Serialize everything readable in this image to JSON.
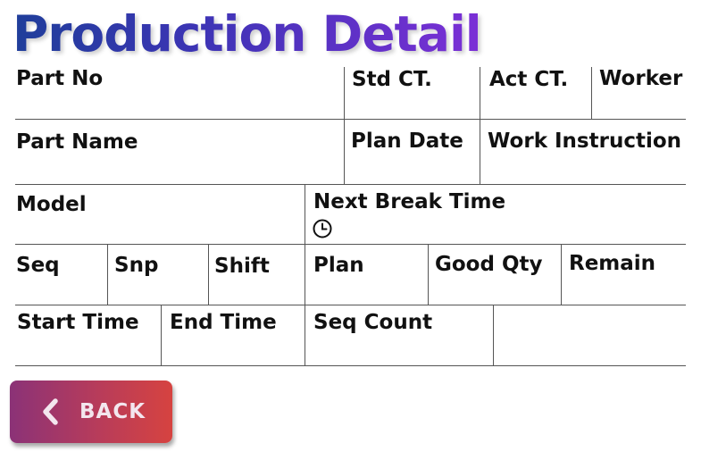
{
  "header": {
    "title": "Production Detail"
  },
  "table": {
    "row1": {
      "part_no": {
        "label": "Part No",
        "value": ""
      },
      "std_ct": {
        "label": "Std CT.",
        "value": ""
      },
      "act_ct": {
        "label": "Act CT.",
        "value": ""
      },
      "worker": {
        "label": "Worker",
        "value": ""
      }
    },
    "row2": {
      "part_name": {
        "label": "Part Name",
        "value": ""
      },
      "plan_date": {
        "label": "Plan Date",
        "value": ""
      },
      "work_instruction": {
        "label": "Work Instruction",
        "value": ""
      }
    },
    "row3": {
      "model": {
        "label": "Model",
        "value": ""
      },
      "next_break_time": {
        "label": "Next Break Time",
        "value": "",
        "icon": "clock-icon"
      }
    },
    "row4": {
      "seq": {
        "label": "Seq",
        "value": ""
      },
      "snp": {
        "label": "Snp",
        "value": ""
      },
      "shift": {
        "label": "Shift",
        "value": ""
      },
      "plan": {
        "label": "Plan",
        "value": ""
      },
      "good_qty": {
        "label": "Good Qty",
        "value": ""
      },
      "remain": {
        "label": "Remain",
        "value": ""
      }
    },
    "row5": {
      "start_time": {
        "label": "Start Time",
        "value": ""
      },
      "end_time": {
        "label": "End Time",
        "value": ""
      },
      "seq_count": {
        "label": "Seq Count",
        "value": ""
      },
      "empty": {
        "label": "",
        "value": ""
      }
    }
  },
  "footer": {
    "back_button": {
      "label": "BACK",
      "icon": "chevron-left-icon"
    }
  },
  "colors": {
    "title_gradient_start": "#1f3e9a",
    "title_gradient_end": "#7b2fd6",
    "back_gradient_start": "#8b3277",
    "back_gradient_end": "#d64340",
    "grid_line": "#555555"
  }
}
